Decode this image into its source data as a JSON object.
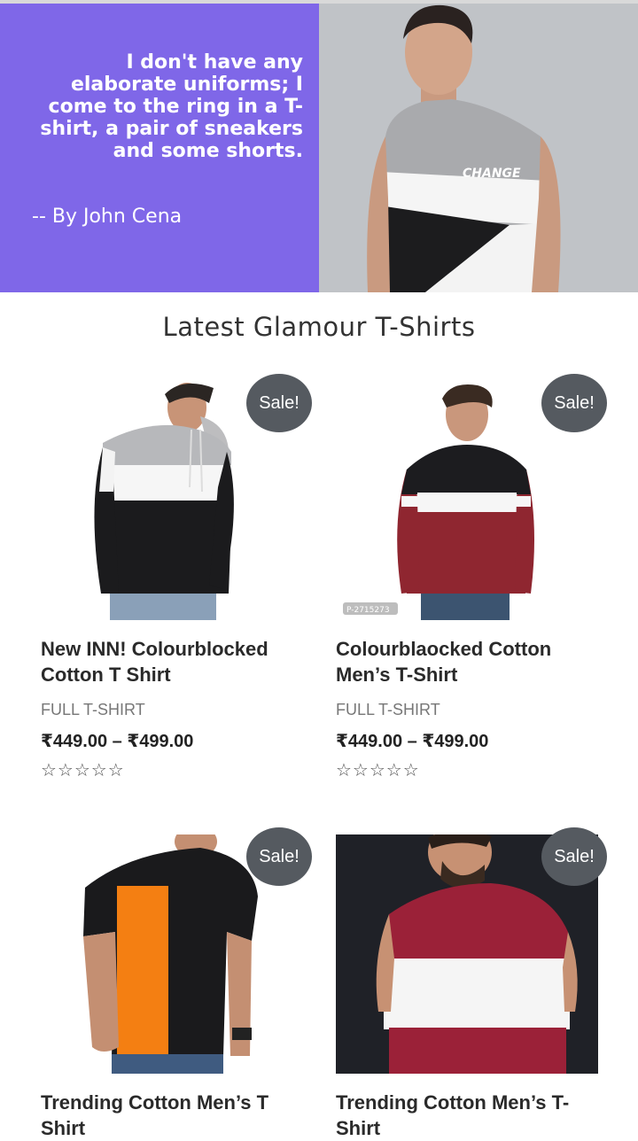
{
  "hero": {
    "quote": "I don't have any elaborate uniforms; I come to the ring in a T-shirt, a pair of sneakers and some shorts.",
    "author": "-- By John Cena",
    "shirt_print": "CHANGE",
    "accent_color": "#7f67e8"
  },
  "section": {
    "title": "Latest Glamour T-Shirts"
  },
  "products": [
    {
      "title_line1": "New INN! Colourblocked",
      "title_line2": "Cotton T Shirt",
      "category": "FULL T-SHIRT",
      "price": "₹449.00 – ₹499.00",
      "badge": "Sale!",
      "stars": "☆☆☆☆☆",
      "rating": 0
    },
    {
      "title_line1": "Colourblaocked Cotton",
      "title_line2": "Men’s T-Shirt",
      "category": "FULL T-SHIRT",
      "price": "₹449.00 – ₹499.00",
      "badge": "Sale!",
      "stars": "☆☆☆☆☆",
      "rating": 0,
      "image_code": "P-2715273"
    },
    {
      "title_line1": "Trending Cotton Men’s T",
      "title_line2": "Shirt",
      "badge": "Sale!"
    },
    {
      "title_line1": "Trending Cotton Men’s T-",
      "title_line2": "Shirt",
      "badge": "Sale!"
    }
  ]
}
